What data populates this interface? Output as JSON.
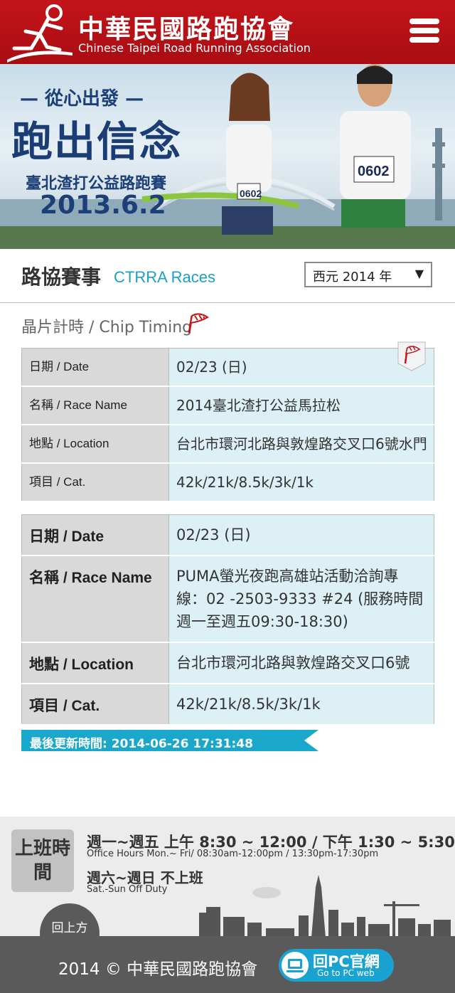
{
  "header": {
    "title_zh": "中華民國路跑協會",
    "title_en": "Chinese Taipei Road Running Association",
    "menu_icon": "hamburger-menu-icon",
    "bg_color": "#b5101a"
  },
  "banner": {
    "subtitle": "— 從心出發 —",
    "headline": "跑出信念",
    "event": "臺北渣打公益路跑賽",
    "date": "2013.6.2",
    "bib_left": "0602",
    "bib_right": "0602"
  },
  "section": {
    "title_zh": "路協賽事",
    "title_en": "CTRRA Races",
    "year_selected": "西元 2014 年",
    "category": "晶片計時 / Chip Timing",
    "accent_color": "#1aa0c8"
  },
  "races": [
    {
      "date_label": "日期 / Date",
      "date": "02/23 (日)",
      "name_label": "名稱 / Race Name",
      "name": "2014臺北渣打公益馬拉松",
      "location_label": "地點 / Location",
      "location": "台北市環河北路與敦煌路交叉口6號水門",
      "cat_label": "項目 / Cat.",
      "cat": "42k/21k/8.5k/3k/1k"
    },
    {
      "date_label": "日期 / Date",
      "date": "02/23 (日)",
      "name_label": "名稱 / Race Name",
      "name": "PUMA螢光夜跑高雄站活動洽詢專線：02 -2503-9333 #24 (服務時間週一至週五09:30-18:30)",
      "location_label": "地點 / Location",
      "location": "台北市環河北路與敦煌路交叉口6號",
      "cat_label": "項目 / Cat.",
      "cat": "42k/21k/8.5k/3k/1k"
    }
  ],
  "update": {
    "text": "最後更新時間: 2014-06-26 17:31:48"
  },
  "footer": {
    "badge": "上班時間",
    "line1": "週一~週五 上午 8:30 ~ 12:00 / 下午 1:30 ~ 5:30",
    "line2": "Office Hours  Mon.~ Fri/ 08:30am-12:00pm / 13:30pm-17:30pm",
    "line3": "週六~週日 不上班",
    "line4": "Sat.-Sun Off Duty",
    "back_to_top": "回上方",
    "copyright": "2014 © 中華民國路跑協會",
    "pc_zh": "回PC官網",
    "pc_en": "Go to PC web"
  }
}
